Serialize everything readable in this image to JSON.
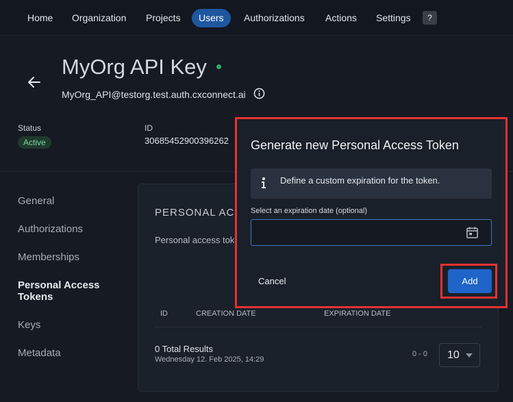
{
  "nav": {
    "items": [
      {
        "label": "Home"
      },
      {
        "label": "Organization"
      },
      {
        "label": "Projects"
      },
      {
        "label": "Users",
        "active": true
      },
      {
        "label": "Authorizations"
      },
      {
        "label": "Actions"
      },
      {
        "label": "Settings"
      }
    ],
    "help_label": "?"
  },
  "header": {
    "title": "MyOrg API Key",
    "email": "MyOrg_API@testorg.test.auth.cxconnect.ai",
    "status_label": "Status",
    "status_value": "Active",
    "id_label": "ID",
    "id_value": "30685452900396262"
  },
  "sidebar": {
    "items": [
      {
        "label": "General"
      },
      {
        "label": "Authorizations"
      },
      {
        "label": "Memberships"
      },
      {
        "label": "Personal Access Tokens",
        "active": true
      },
      {
        "label": "Keys"
      },
      {
        "label": "Metadata"
      }
    ]
  },
  "card": {
    "title": "PERSONAL ACCESS TOKENS",
    "description": "Personal access tokens",
    "columns": [
      "ID",
      "CREATION DATE",
      "EXPIRATION DATE"
    ],
    "total": "0 Total Results",
    "timestamp": "Wednesday 12. Feb 2025, 14:29",
    "range": "0 - 0",
    "page_size": "10"
  },
  "modal": {
    "title": "Generate new Personal Access Token",
    "notice": "Define a custom expiration for the token.",
    "field_label": "Select an expiration date (optional)",
    "field_value": "",
    "cancel_label": "Cancel",
    "add_label": "Add"
  },
  "colors": {
    "accent": "#1f64c8",
    "active_nav": "#1e56a0",
    "highlight": "#e53232",
    "status_green": "#2fa86a"
  }
}
